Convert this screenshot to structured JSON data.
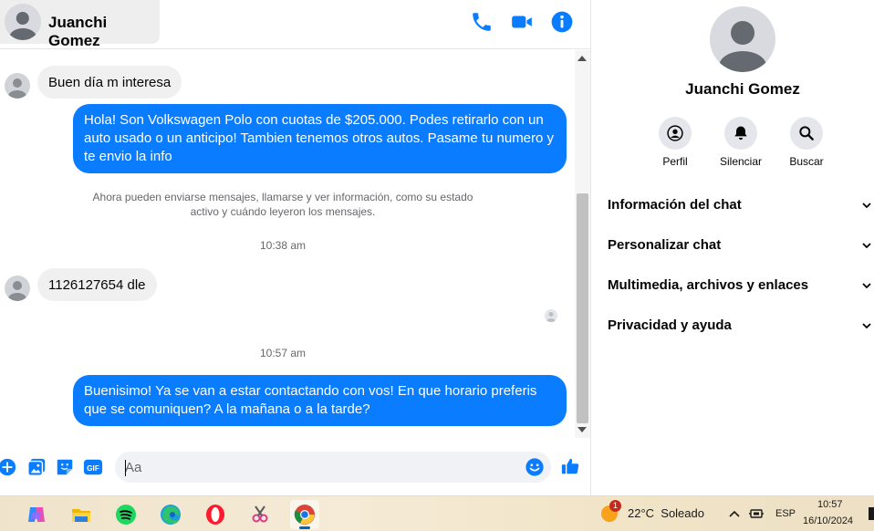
{
  "header": {
    "contact_name": "Juanchi Gomez",
    "icons": [
      "phone-icon",
      "video-icon",
      "info-icon"
    ]
  },
  "colors": {
    "accent": "#0a7cff",
    "incoming_bubble": "#f0f0f0",
    "system_text": "#65676b"
  },
  "messages": {
    "m1": "Buen día m interesa",
    "m2": "Hola! Son Volkswagen Polo con cuotas de $205.000. Podes retirarlo con un auto usado o un anticipo! Tambien tenemos otros autos. Pasame tu numero y te envio la info",
    "system_note": "Ahora pueden enviarse mensajes, llamarse y ver información, como su estado activo y cuándo leyeron los mensajes.",
    "time1": "10:38 am",
    "m3": "1126127654 dle",
    "time2": "10:57 am",
    "m4": "Buenisimo! Ya se van a estar contactando con vos! En que horario preferis que se comuniquen? A la mañana o a la tarde?"
  },
  "composer": {
    "placeholder": "Aa",
    "gif_label": "GIF",
    "icons": [
      "plus-icon",
      "image-icon",
      "sticker-icon",
      "gif-icon",
      "emoji-icon",
      "thumbs-up-icon"
    ]
  },
  "info_panel": {
    "name": "Juanchi Gomez",
    "actions": {
      "profile": "Perfil",
      "mute": "Silenciar",
      "search": "Buscar"
    },
    "sections": {
      "chat_info": "Información del chat",
      "customize": "Personalizar chat",
      "media": "Multimedia, archivos y enlaces",
      "privacy": "Privacidad y ayuda"
    }
  },
  "taskbar": {
    "apps": [
      "copilot-icon",
      "file-explorer-icon",
      "spotify-icon",
      "edge-icon",
      "opera-icon",
      "snipping-icon",
      "chrome-icon"
    ],
    "weather_badge": "1",
    "weather": "22°C  Soleado",
    "language": "ESP",
    "time": "10:57",
    "date": "16/10/2024"
  }
}
